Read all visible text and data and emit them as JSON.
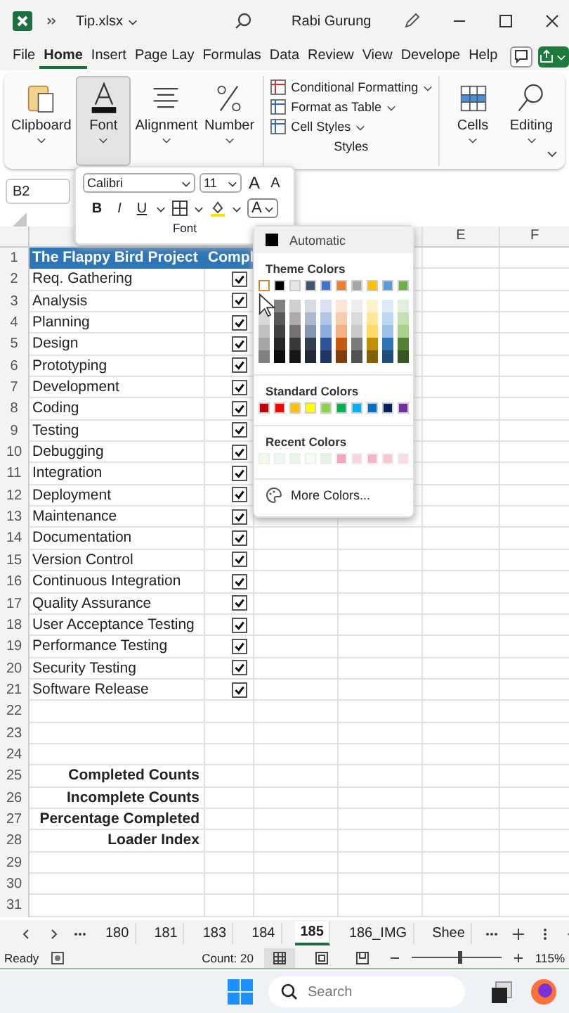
{
  "title_bar": {
    "file_name": "Tip.xlsx",
    "user_name": "Rabi Gurung"
  },
  "menu_tabs": [
    {
      "label": "File",
      "selected": false
    },
    {
      "label": "Home",
      "selected": true
    },
    {
      "label": "Insert",
      "selected": false
    },
    {
      "label": "Page Lay",
      "selected": false
    },
    {
      "label": "Formulas",
      "selected": false
    },
    {
      "label": "Data",
      "selected": false
    },
    {
      "label": "Review",
      "selected": false
    },
    {
      "label": "View",
      "selected": false
    },
    {
      "label": "Develope",
      "selected": false
    },
    {
      "label": "Help",
      "selected": false
    }
  ],
  "ribbon": {
    "left_groups": [
      {
        "label": "Clipboard",
        "selected": false
      },
      {
        "label": "Font",
        "selected": true
      },
      {
        "label": "Alignment",
        "selected": false
      },
      {
        "label": "Number",
        "selected": false
      }
    ],
    "styles": {
      "label": "Styles",
      "items": [
        "Conditional Formatting",
        "Format as Table",
        "Cell Styles"
      ]
    },
    "right_groups": [
      {
        "label": "Cells",
        "selected": false
      },
      {
        "label": "Editing",
        "selected": false
      }
    ]
  },
  "name_box": "B2",
  "font_popup": {
    "font_name": "Calibri",
    "font_size": "11",
    "grow": "A",
    "shrink": "A",
    "bold": "B",
    "italic": "I",
    "underline": "U",
    "font_color": "A",
    "label": "Font"
  },
  "color_picker": {
    "automatic": "Automatic",
    "theme_heading": "Theme Colors",
    "theme_colors": [
      {
        "color": "#ffffff",
        "selected": true,
        "shades": [
          {
            "color": "#f2f2f2"
          },
          {
            "color": "#d9d9d9"
          },
          {
            "color": "#bfbfbf"
          },
          {
            "color": "#a6a6a6"
          },
          {
            "color": "#808080"
          }
        ]
      },
      {
        "color": "#000000",
        "selected": false,
        "shades": [
          {
            "color": "#808080"
          },
          {
            "color": "#595959"
          },
          {
            "color": "#404040"
          },
          {
            "color": "#262626"
          },
          {
            "color": "#0d0d0d"
          }
        ]
      },
      {
        "color": "#e7e6e6",
        "selected": false,
        "shades": [
          {
            "color": "#d0cece"
          },
          {
            "color": "#aeaaaa"
          },
          {
            "color": "#757171"
          },
          {
            "color": "#3a3838"
          },
          {
            "color": "#161616"
          }
        ]
      },
      {
        "color": "#44546a",
        "selected": false,
        "shades": [
          {
            "color": "#d6dce4"
          },
          {
            "color": "#adb9ca"
          },
          {
            "color": "#8497b0"
          },
          {
            "color": "#333f4f"
          },
          {
            "color": "#222a35"
          }
        ]
      },
      {
        "color": "#4472c4",
        "selected": false,
        "shades": [
          {
            "color": "#d9e1f2"
          },
          {
            "color": "#b4c6e7"
          },
          {
            "color": "#8ea9db"
          },
          {
            "color": "#305496"
          },
          {
            "color": "#203764"
          }
        ]
      },
      {
        "color": "#ed7d31",
        "selected": false,
        "shades": [
          {
            "color": "#fce4d6"
          },
          {
            "color": "#f8cbad"
          },
          {
            "color": "#f4b084"
          },
          {
            "color": "#c65911"
          },
          {
            "color": "#833c0b"
          }
        ]
      },
      {
        "color": "#a5a5a5",
        "selected": false,
        "shades": [
          {
            "color": "#ededed"
          },
          {
            "color": "#dbdbdb"
          },
          {
            "color": "#c9c9c9"
          },
          {
            "color": "#7b7b7b"
          },
          {
            "color": "#525252"
          }
        ]
      },
      {
        "color": "#ffc000",
        "selected": false,
        "shades": [
          {
            "color": "#fff2cc"
          },
          {
            "color": "#ffe699"
          },
          {
            "color": "#ffd966"
          },
          {
            "color": "#bf8f00"
          },
          {
            "color": "#806000"
          }
        ]
      },
      {
        "color": "#5b9bd5",
        "selected": false,
        "shades": [
          {
            "color": "#ddebf7"
          },
          {
            "color": "#bdd7ee"
          },
          {
            "color": "#9bc2e6"
          },
          {
            "color": "#2f75b5"
          },
          {
            "color": "#1f4e78"
          }
        ]
      },
      {
        "color": "#70ad47",
        "selected": false,
        "shades": [
          {
            "color": "#e2efda"
          },
          {
            "color": "#c6e0b4"
          },
          {
            "color": "#a9d08e"
          },
          {
            "color": "#548235"
          },
          {
            "color": "#375623"
          }
        ]
      }
    ],
    "standard_heading": "Standard Colors",
    "standard_colors": [
      {
        "color": "#c00000"
      },
      {
        "color": "#ff0000"
      },
      {
        "color": "#ffc000"
      },
      {
        "color": "#ffff00"
      },
      {
        "color": "#92d050"
      },
      {
        "color": "#00b050"
      },
      {
        "color": "#00b0f0"
      },
      {
        "color": "#0070c0"
      },
      {
        "color": "#002060"
      },
      {
        "color": "#7030a0"
      }
    ],
    "recent_heading": "Recent Colors",
    "recent_colors": [
      {
        "color": "#f4fbec"
      },
      {
        "color": "#eef8f0"
      },
      {
        "color": "#e8f6ea"
      },
      {
        "color": "#f6fbf6"
      },
      {
        "color": "#e4f4e4"
      },
      {
        "color": "#f2a7b8"
      },
      {
        "color": "#f8d5de"
      },
      {
        "color": "#f4b6c6"
      },
      {
        "color": "#f6c8d4"
      },
      {
        "color": "#f8dce2"
      }
    ],
    "more_colors": "More Colors..."
  },
  "sheet": {
    "column_headers": [
      "E",
      "F"
    ],
    "rows": [
      {
        "num": "1",
        "kind": "header",
        "a": "The Flappy Bird Project",
        "b": "Compl"
      },
      {
        "num": "2",
        "kind": "task",
        "a": "Req. Gathering",
        "checked": true
      },
      {
        "num": "3",
        "kind": "task",
        "a": "Analysis",
        "checked": true
      },
      {
        "num": "4",
        "kind": "task",
        "a": "Planning",
        "checked": true
      },
      {
        "num": "5",
        "kind": "task",
        "a": "Design",
        "checked": true
      },
      {
        "num": "6",
        "kind": "task",
        "a": "Prototyping",
        "checked": true
      },
      {
        "num": "7",
        "kind": "task",
        "a": "Development",
        "checked": true
      },
      {
        "num": "8",
        "kind": "task",
        "a": "Coding",
        "checked": true
      },
      {
        "num": "9",
        "kind": "task",
        "a": "Testing",
        "checked": true
      },
      {
        "num": "10",
        "kind": "task",
        "a": "Debugging",
        "checked": true
      },
      {
        "num": "11",
        "kind": "task",
        "a": "Integration",
        "checked": true
      },
      {
        "num": "12",
        "kind": "task",
        "a": "Deployment",
        "checked": true
      },
      {
        "num": "13",
        "kind": "task",
        "a": "Maintenance",
        "checked": true
      },
      {
        "num": "14",
        "kind": "task",
        "a": "Documentation",
        "checked": true
      },
      {
        "num": "15",
        "kind": "task",
        "a": "Version Control",
        "checked": true
      },
      {
        "num": "16",
        "kind": "task",
        "a": "Continuous Integration",
        "checked": true
      },
      {
        "num": "17",
        "kind": "task",
        "a": "Quality Assurance",
        "checked": true
      },
      {
        "num": "18",
        "kind": "task",
        "a": "User Acceptance Testing",
        "checked": true
      },
      {
        "num": "19",
        "kind": "task",
        "a": "Performance Testing",
        "checked": true
      },
      {
        "num": "20",
        "kind": "task",
        "a": "Security Testing",
        "checked": true
      },
      {
        "num": "21",
        "kind": "task",
        "a": "Software Release",
        "checked": true
      },
      {
        "num": "22",
        "kind": "blank"
      },
      {
        "num": "23",
        "kind": "blank"
      },
      {
        "num": "24",
        "kind": "blank"
      },
      {
        "num": "25",
        "kind": "summary",
        "a": "Completed Counts"
      },
      {
        "num": "26",
        "kind": "summary",
        "a": "Incomplete Counts"
      },
      {
        "num": "27",
        "kind": "summary",
        "a": "Percentage Completed"
      },
      {
        "num": "28",
        "kind": "summary",
        "a": "Loader Index"
      },
      {
        "num": "29",
        "kind": "blank"
      },
      {
        "num": "30",
        "kind": "blank"
      },
      {
        "num": "31",
        "kind": "blank"
      }
    ]
  },
  "sheet_tabs": [
    {
      "label": "180",
      "selected": false
    },
    {
      "label": "181",
      "selected": false
    },
    {
      "label": "183",
      "selected": false
    },
    {
      "label": "184",
      "selected": false
    },
    {
      "label": "185",
      "selected": true
    },
    {
      "label": "186_IMG",
      "selected": false
    },
    {
      "label": "Shee",
      "selected": false
    }
  ],
  "status_bar": {
    "ready": "Ready",
    "count": "Count: 20",
    "zoom": {
      "level": 0.53
    },
    "zoom_reading": "115%"
  },
  "taskbar": {
    "search_placeholder": "Search"
  }
}
